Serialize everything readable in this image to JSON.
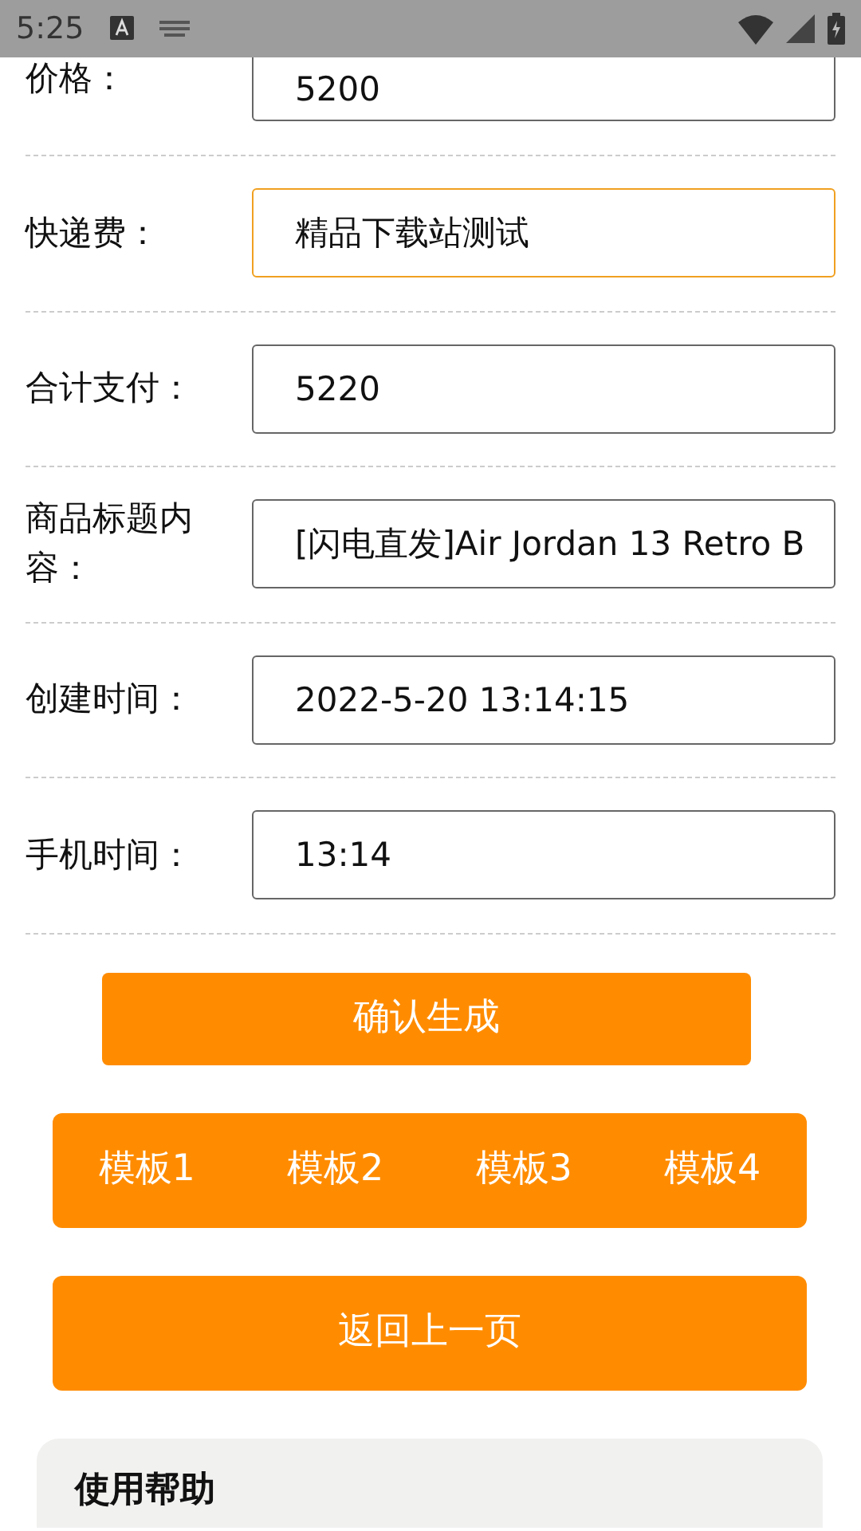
{
  "status_bar": {
    "time": "5:25"
  },
  "fields": [
    {
      "label": "价格：",
      "value": "5200",
      "focused": false
    },
    {
      "label": "快递费：",
      "value": "精品下载站测试",
      "focused": true
    },
    {
      "label": "合计支付：",
      "value": "5220",
      "focused": false
    },
    {
      "label": "商品标题内容：",
      "value": "[闪电直发]Air Jordan 13 Retro B",
      "focused": false
    },
    {
      "label": "创建时间：",
      "value": "2022-5-20 13:14:15",
      "focused": false
    },
    {
      "label": "手机时间：",
      "value": "13:14",
      "focused": false
    }
  ],
  "confirm_button": "确认生成",
  "templates": [
    "模板1",
    "模板2",
    "模板3",
    "模板4"
  ],
  "back_button": "返回上一页",
  "help": {
    "title": "使用帮助"
  }
}
